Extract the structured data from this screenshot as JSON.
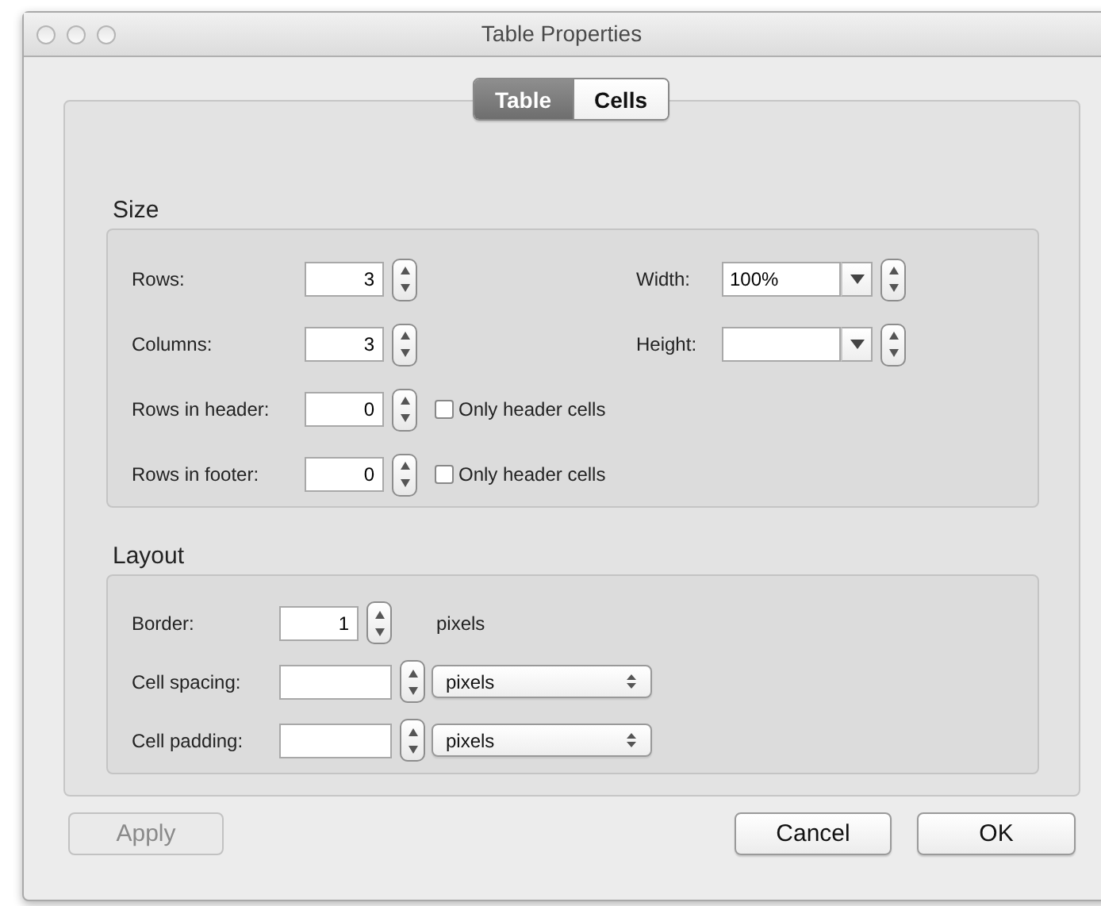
{
  "window": {
    "title": "Table Properties"
  },
  "tabs": [
    {
      "label": "Table",
      "selected": true
    },
    {
      "label": "Cells",
      "selected": false
    }
  ],
  "size": {
    "heading": "Size",
    "left_rows": [
      {
        "label": "Rows:",
        "value": "3"
      },
      {
        "label": "Columns:",
        "value": "3"
      },
      {
        "label": "Rows in header:",
        "value": "0",
        "option": {
          "label": "Only header cells",
          "checked": false
        }
      },
      {
        "label": "Rows in footer:",
        "value": "0",
        "option": {
          "label": "Only header cells",
          "checked": false
        }
      }
    ],
    "right_rows": [
      {
        "label": "Width:",
        "value": "100%"
      },
      {
        "label": "Height:",
        "value": ""
      }
    ]
  },
  "layout": {
    "heading": "Layout",
    "rows": [
      {
        "label": "Border:",
        "value": "1",
        "kind": "unit-text",
        "unit": "pixels"
      },
      {
        "label": "Cell spacing:",
        "value": "",
        "kind": "unit-select",
        "unit": "pixels"
      },
      {
        "label": "Cell padding:",
        "value": "",
        "kind": "unit-select",
        "unit": "pixels"
      }
    ]
  },
  "buttons": [
    {
      "label": "Apply",
      "disabled": true
    },
    {
      "label": "Cancel",
      "disabled": false
    },
    {
      "label": "OK",
      "disabled": false
    }
  ]
}
